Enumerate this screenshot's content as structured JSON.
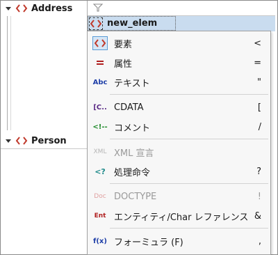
{
  "tree": {
    "address_label": "Address",
    "person_label": "Person"
  },
  "grid": {
    "new_element_label": "new_elem"
  },
  "menu": {
    "items": [
      {
        "icon": "element-icon",
        "label": "要素",
        "shortcut": "<"
      },
      {
        "icon": "attribute-icon",
        "label": "属性",
        "shortcut": "="
      },
      {
        "icon": "text-icon",
        "icon_text": "Abc",
        "label": "テキスト",
        "shortcut": "\""
      },
      {
        "icon": "cdata-icon",
        "icon_text": "[C..",
        "label": "CDATA",
        "shortcut": "["
      },
      {
        "icon": "comment-icon",
        "icon_text": "<!--",
        "label": "コメント",
        "shortcut": "/"
      },
      {
        "icon": "xml-declaration-icon",
        "icon_text": "XML",
        "label": "XML 宣言",
        "shortcut": ""
      },
      {
        "icon": "processing-instruction-icon",
        "icon_text": "<?",
        "label": "処理命令",
        "shortcut": "?"
      },
      {
        "icon": "doctype-icon",
        "icon_text": "Doc",
        "label": "DOCTYPE",
        "shortcut": "!"
      },
      {
        "icon": "entity-icon",
        "icon_text": "Ent",
        "label": "エンティティ/Char レファレンス",
        "shortcut": "&"
      },
      {
        "icon": "formula-icon",
        "icon_text": "f(x)",
        "label": "フォーミュラ (F)",
        "shortcut": ","
      }
    ]
  },
  "colors": {
    "element_red": "#c0392b",
    "selection_blue": "#c9dcef",
    "menu_bg": "#f7f7f7",
    "disabled_gray": "#9a9a9a"
  }
}
